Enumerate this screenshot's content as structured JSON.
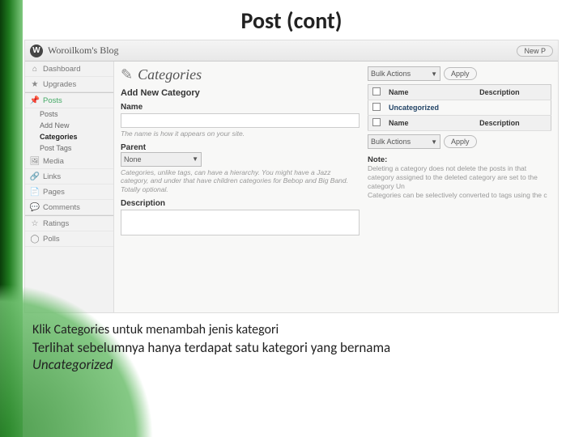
{
  "slide": {
    "title": "Post (cont)",
    "caption1": "Klik Categories untuk menambah jenis kategori",
    "caption2": "Terlihat sebelumnya hanya terdapat satu kategori yang bernama",
    "caption3": "Uncategorized"
  },
  "header": {
    "blog_name": "Woroilkom's Blog",
    "new_post_btn": "New P"
  },
  "sidebar": {
    "dashboard": "Dashboard",
    "upgrades": "Upgrades",
    "posts": "Posts",
    "posts_sub": {
      "posts": "Posts",
      "add_new": "Add New",
      "categories": "Categories",
      "post_tags": "Post Tags"
    },
    "media": "Media",
    "links": "Links",
    "pages": "Pages",
    "comments": "Comments",
    "ratings": "Ratings",
    "polls": "Polls"
  },
  "main": {
    "page_title": "Categories",
    "add_new_heading": "Add New Category",
    "name_label": "Name",
    "name_hint": "The name is how it appears on your site.",
    "parent_label": "Parent",
    "parent_value": "None",
    "parent_hint": "Categories, unlike tags, can have a hierarchy. You might have a Jazz category, and under that have children categories for Bebop and Big Band. Totally optional.",
    "description_label": "Description"
  },
  "table": {
    "bulk_label": "Bulk Actions",
    "apply_label": "Apply",
    "col_name": "Name",
    "col_desc": "Description",
    "row1_name": "Uncategorized",
    "note_head": "Note:",
    "note_text1": "Deleting a category does not delete the posts in that category assigned to the deleted category are set to the category Un",
    "note_text2": "Categories can be selectively converted to tags using the c"
  }
}
